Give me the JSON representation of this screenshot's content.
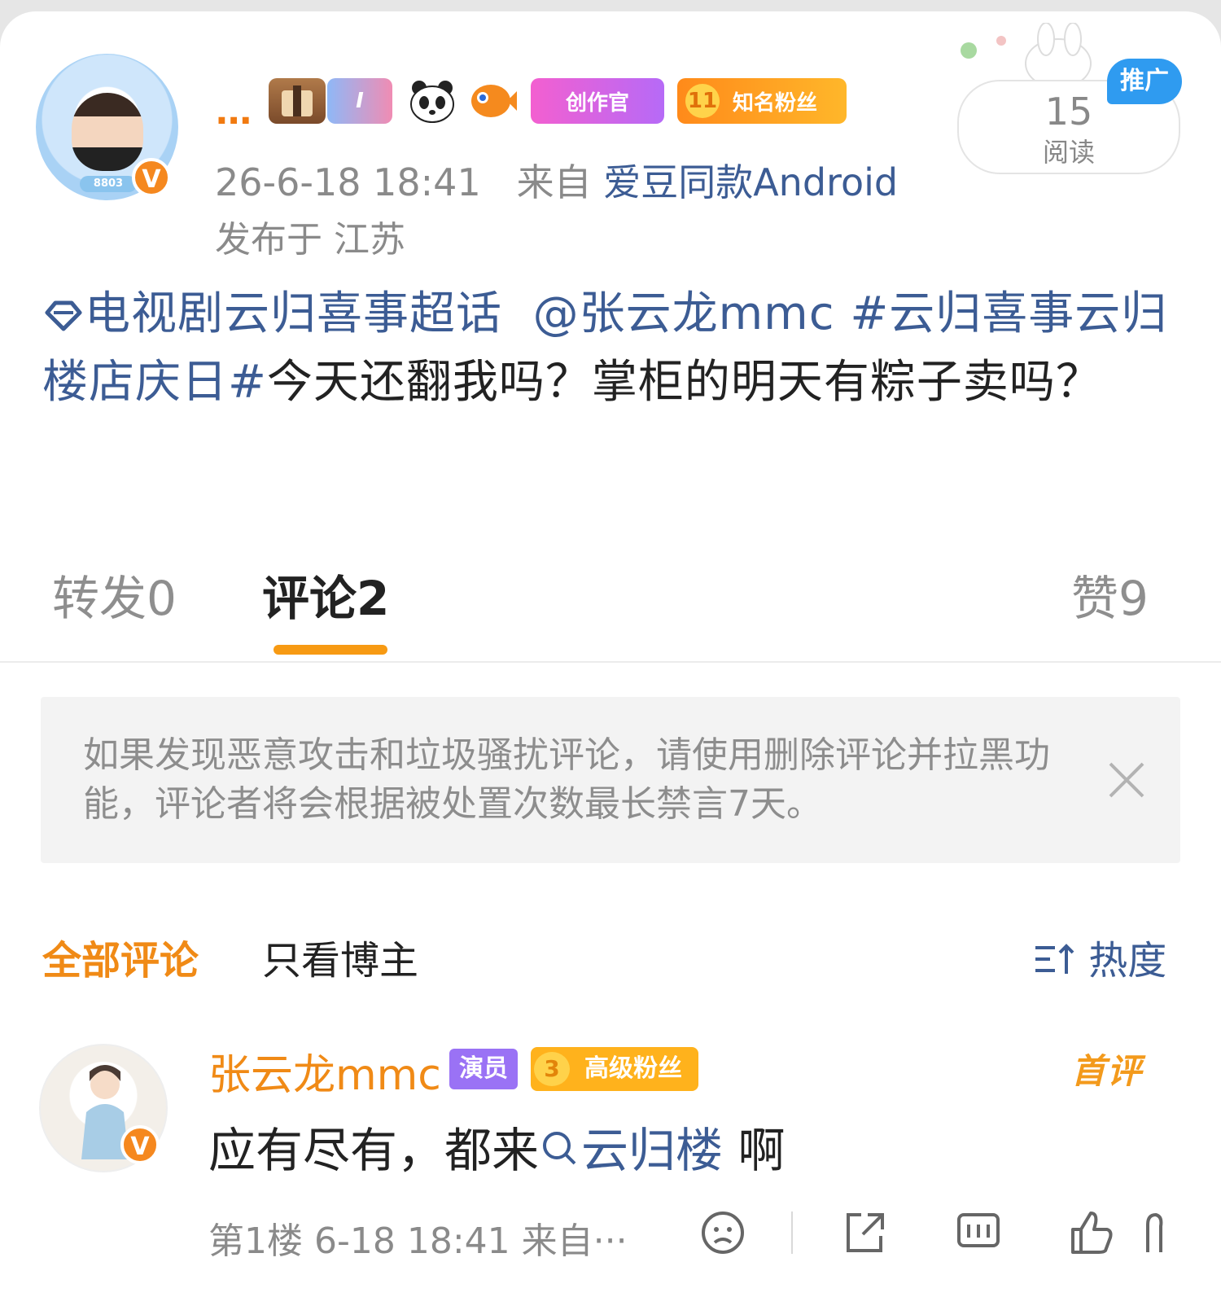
{
  "header": {
    "username_truncated": "...",
    "badges": [
      {
        "icon": "box-icon",
        "label": ""
      },
      {
        "icon": "level-i-badge",
        "label": "I"
      },
      {
        "icon": "panda-icon",
        "label": ""
      },
      {
        "icon": "fish-icon",
        "label": ""
      },
      {
        "icon": "creator-badge",
        "label": "创作官"
      },
      {
        "icon": "fan-level-badge",
        "level": "11",
        "label": "知名粉丝"
      }
    ],
    "time": "26-6-18 18:41",
    "source_prefix": "来自",
    "source_name": "爱豆同款Android",
    "location": "发布于 江苏",
    "read_count": "15",
    "read_label": "阅读",
    "promo_label": "推广"
  },
  "post": {
    "supertopic": "电视剧云归喜事超话",
    "mention": "@张云龙mmc",
    "hashtag": "#云归喜事云归楼店庆日#",
    "text": "今天还翻我吗？掌柜的明天有粽子卖吗？"
  },
  "tabs": {
    "repost": "转发",
    "repost_count": "0",
    "comment": "评论",
    "comment_count": "2",
    "like": "赞",
    "like_count": "9"
  },
  "notice": {
    "text": "如果发现恶意攻击和垃圾骚扰评论，请使用删除评论并拉黑功能，评论者将会根据被处置次数最长禁言7天。"
  },
  "filter": {
    "all": "全部评论",
    "host_only": "只看博主",
    "sort": "热度"
  },
  "comment": {
    "author": "张云龙mmc",
    "role_tag": "演员",
    "fan_level": "3",
    "fan_label": "高级粉丝",
    "first_label": "首评",
    "text_before": "应有尽有，都来",
    "search_link": "云归楼",
    "text_after": " 啊",
    "floor": "第1楼",
    "time": "6-18 18:41",
    "source": "来自···"
  },
  "colors": {
    "accent_orange": "#f08a16",
    "link_blue": "#3c5c94",
    "verify_orange": "#f5881f",
    "promo_blue": "#2f9bf0",
    "actor_purple": "#9a72f5",
    "fan_gold": "#ffb21c"
  }
}
